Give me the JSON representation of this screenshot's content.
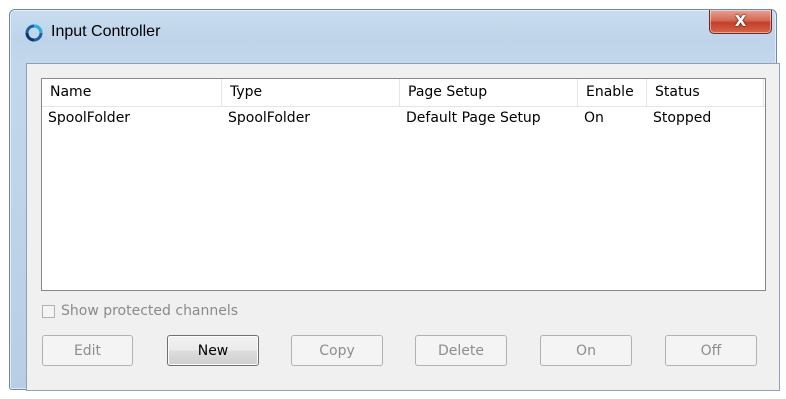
{
  "window": {
    "title": "Input Controller",
    "close_label": "X"
  },
  "list": {
    "columns": [
      "Name",
      "Type",
      "Page Setup",
      "Enable",
      "Status"
    ],
    "rows": [
      [
        "SpoolFolder",
        "SpoolFolder",
        "Default Page Setup",
        "On",
        "Stopped"
      ]
    ]
  },
  "options": {
    "show_protected_label": "Show protected channels",
    "show_protected_checked": false
  },
  "buttons": {
    "edit": "Edit",
    "new": "New",
    "copy": "Copy",
    "delete": "Delete",
    "on": "On",
    "off": "Off"
  },
  "colors": {
    "frame": "#c3d7ec",
    "client": "#f0f0f0",
    "close": "#c8452f",
    "disabled_text": "#8d8d8d"
  },
  "icons": {
    "app": "app-logo-icon",
    "close": "close-icon"
  }
}
